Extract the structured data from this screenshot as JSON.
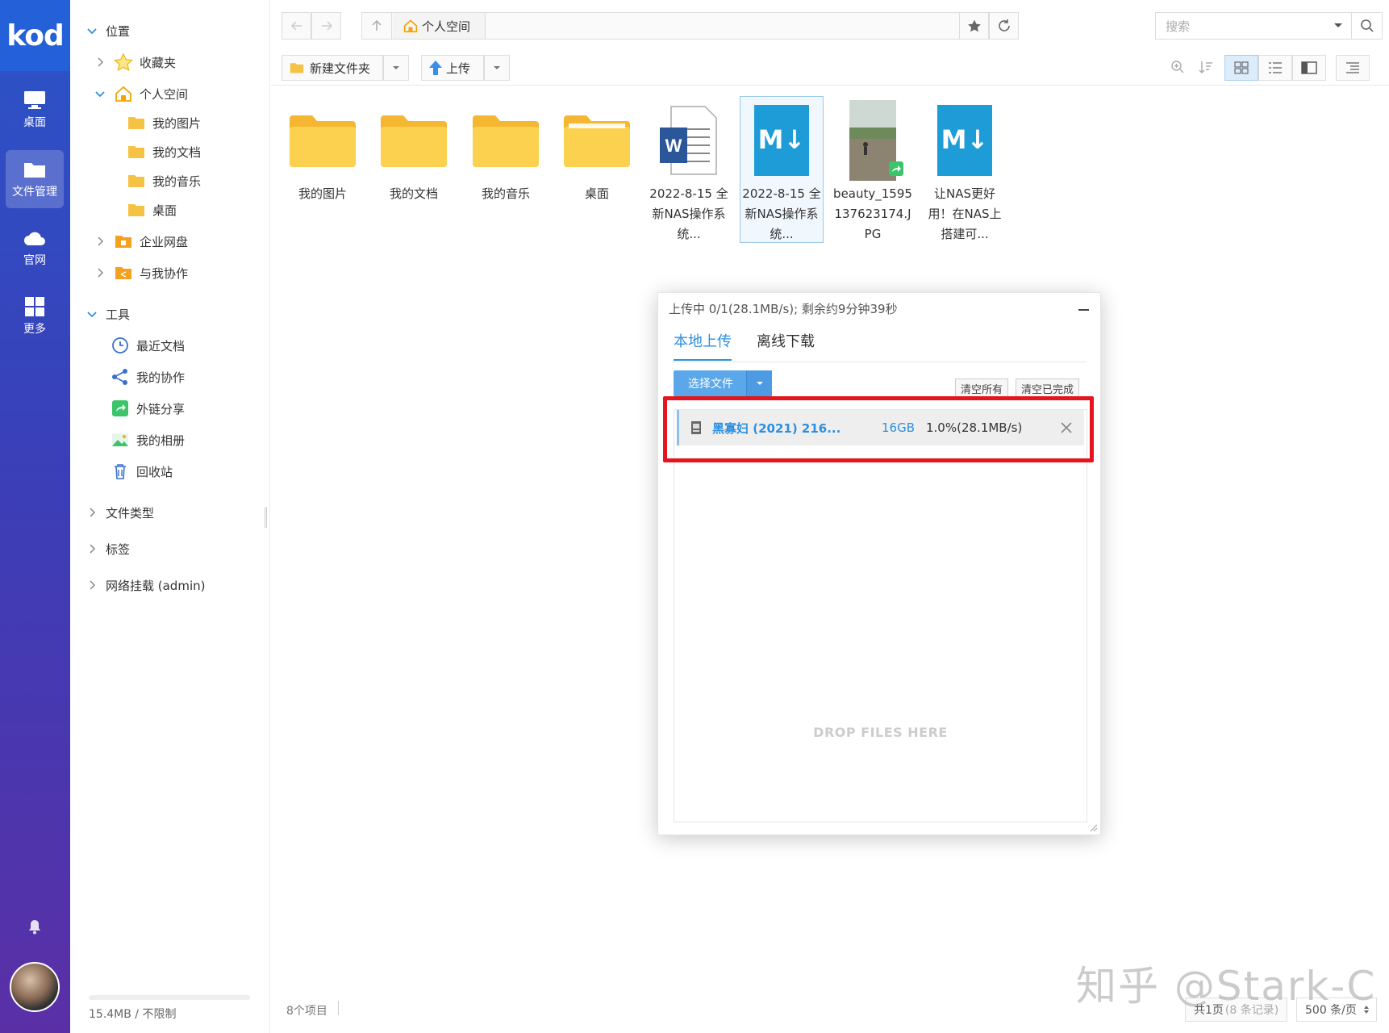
{
  "app": {
    "logo": "kod"
  },
  "rail": {
    "items": [
      {
        "label": "桌面",
        "icon": "monitor-icon"
      },
      {
        "label": "文件管理",
        "icon": "folder-icon",
        "active": true
      },
      {
        "label": "官网",
        "icon": "cloud-icon"
      },
      {
        "label": "更多",
        "icon": "grid-icon"
      }
    ]
  },
  "tree": {
    "sections": {
      "location": "位置",
      "favorites": "收藏夹",
      "personal": "个人空间",
      "my_pictures": "我的图片",
      "my_documents": "我的文档",
      "my_music": "我的音乐",
      "desktop": "桌面",
      "enterprise": "企业网盘",
      "shared_with_me": "与我协作",
      "tools": "工具",
      "recent": "最近文档",
      "my_collab": "我的协作",
      "link_share": "外链分享",
      "my_album": "我的相册",
      "recycle": "回收站",
      "file_types": "文件类型",
      "tags": "标签",
      "network_mount": "网络挂载 (admin)"
    },
    "quota": "15.4MB / 不限制"
  },
  "toolbar": {
    "breadcrumb": "个人空间",
    "search_placeholder": "搜索",
    "new_folder": "新建文件夹",
    "upload": "上传"
  },
  "files": [
    {
      "name": "我的图片",
      "type": "folder"
    },
    {
      "name": "我的文档",
      "type": "folder"
    },
    {
      "name": "我的音乐",
      "type": "folder"
    },
    {
      "name": "桌面",
      "type": "folder"
    },
    {
      "name": "2022-8-15 全新NAS操作系统...",
      "type": "word"
    },
    {
      "name": "2022-8-15 全新NAS操作系统...",
      "type": "markdown",
      "selected": true
    },
    {
      "name": "beauty_1595137623174.JPG",
      "type": "image"
    },
    {
      "name": "让NAS更好用！在NAS上搭建可...",
      "type": "markdown"
    }
  ],
  "upload_dialog": {
    "title": "上传中 0/1(28.1MB/s); 剩余约9分钟39秒",
    "tabs": [
      "本地上传",
      "离线下载"
    ],
    "choose_file": "选择文件",
    "clear_all": "清空所有",
    "clear_done": "清空已完成",
    "item": {
      "name": "黑寡妇 (2021) 216...",
      "size": "16GB",
      "progress": "1.0%(28.1MB/s)",
      "progress_fraction": 0.01
    },
    "drop_hint": "DROP FILES HERE"
  },
  "status": {
    "item_count": "8个项目",
    "pages": "共1页",
    "records": "(8 条记录)",
    "per_page": "500 条/页"
  },
  "watermark": "知乎 @Stark-C",
  "colors": {
    "accent": "#2d8fe0",
    "highlight": "#e5151e",
    "folder": "#f6c244"
  }
}
